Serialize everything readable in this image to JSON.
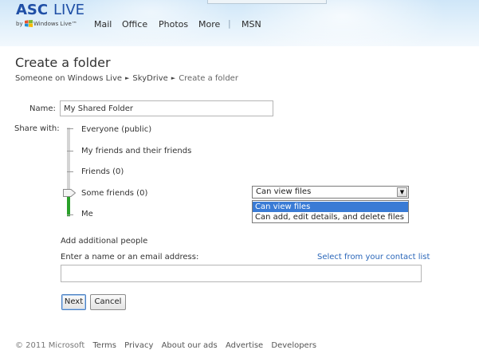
{
  "brand": {
    "logo_main": "ASC",
    "logo_live": "LIVE",
    "by": "by",
    "windows_live": "Windows Live™"
  },
  "nav": {
    "items": [
      "Mail",
      "Office",
      "Photos",
      "More",
      "MSN"
    ],
    "separator": "|"
  },
  "page": {
    "title": "Create a folder",
    "breadcrumb": [
      "Someone on Windows Live",
      "SkyDrive",
      "Create a folder"
    ],
    "breadcrumb_separator": "►"
  },
  "form": {
    "name_label": "Name:",
    "name_value": "My Shared Folder",
    "share_label": "Share with:",
    "share_options": [
      "Everyone (public)",
      "My friends and their friends",
      "Friends (0)",
      "Some friends (0)",
      "Me"
    ],
    "selected_share_option": "Some friends (0)",
    "permission_select": {
      "value": "Can view files",
      "options": [
        "Can view files",
        "Can add, edit details, and delete files"
      ]
    },
    "add_people_label": "Add additional people",
    "enter_label": "Enter a name or an email address:",
    "contact_link": "Select from your contact list",
    "people_value": "",
    "next_button": "Next",
    "cancel_button": "Cancel"
  },
  "footer": {
    "copyright": "© 2011 Microsoft",
    "links": [
      "Terms",
      "Privacy",
      "About our ads",
      "Advertise",
      "Developers"
    ]
  },
  "colors": {
    "brand_blue": "#1f4fa6",
    "link_blue": "#2a66b9",
    "slider_green": "#2aa12a",
    "dropdown_highlight": "#3a7bd5"
  }
}
